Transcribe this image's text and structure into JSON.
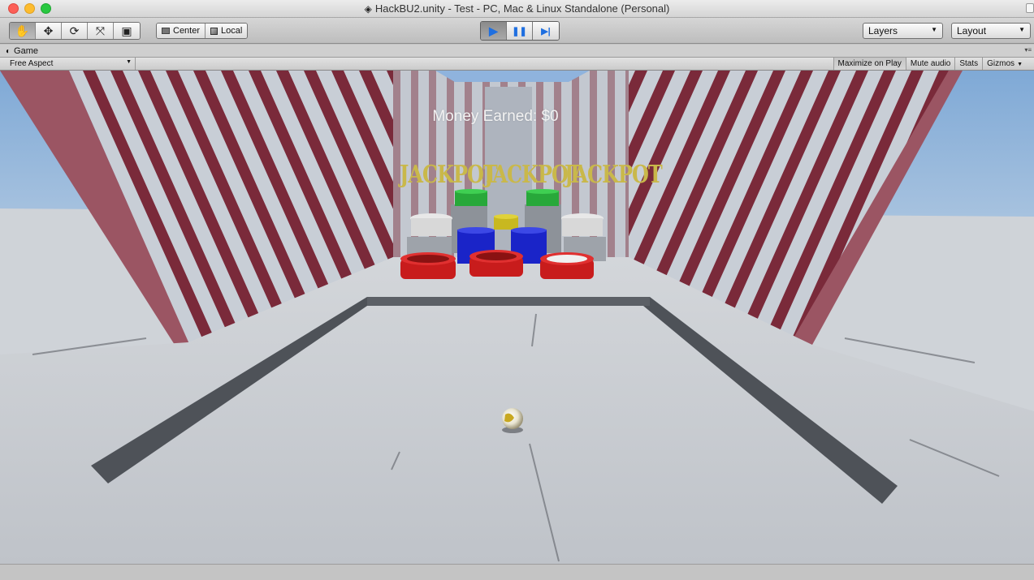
{
  "window": {
    "title": "HackBU2.unity - Test - PC, Mac & Linux Standalone (Personal)"
  },
  "toolbar": {
    "transform_tools": [
      {
        "name": "hand-tool",
        "icon": "hand-icon",
        "glyph": "✋"
      },
      {
        "name": "move-tool",
        "icon": "move-arrows-icon",
        "glyph": "✥"
      },
      {
        "name": "rotate-tool",
        "icon": "rotate-icon",
        "glyph": "⟳"
      },
      {
        "name": "scale-tool",
        "icon": "scale-icon",
        "glyph": "⤧"
      },
      {
        "name": "rect-tool",
        "icon": "rect-tool-icon",
        "glyph": "▣"
      }
    ],
    "pivot_label": "Center",
    "space_label": "Local",
    "play_glyph": "▶",
    "pause_glyph": "❚❚",
    "step_glyph": "▶|",
    "layers_label": "Layers",
    "layout_label": "Layout"
  },
  "tab": {
    "label": "Game"
  },
  "game_view": {
    "aspect_label": "Free Aspect",
    "maximize_label": "Maximize on Play",
    "mute_label": "Mute audio",
    "stats_label": "Stats",
    "gizmos_label": "Gizmos"
  },
  "scene": {
    "money_text": "Money Earned: $0",
    "jackpot_text": "JACKPOT",
    "colors": {
      "stripe_red": "#7a2a3a",
      "stripe_light": "#c7cdd6",
      "bucket_red": "#c81c1c",
      "bucket_blue": "#1420c0",
      "bucket_green": "#28a83a",
      "bucket_yellow": "#c8b820",
      "floor": "#c8cbd0",
      "sky": "#8fb6dd"
    }
  }
}
